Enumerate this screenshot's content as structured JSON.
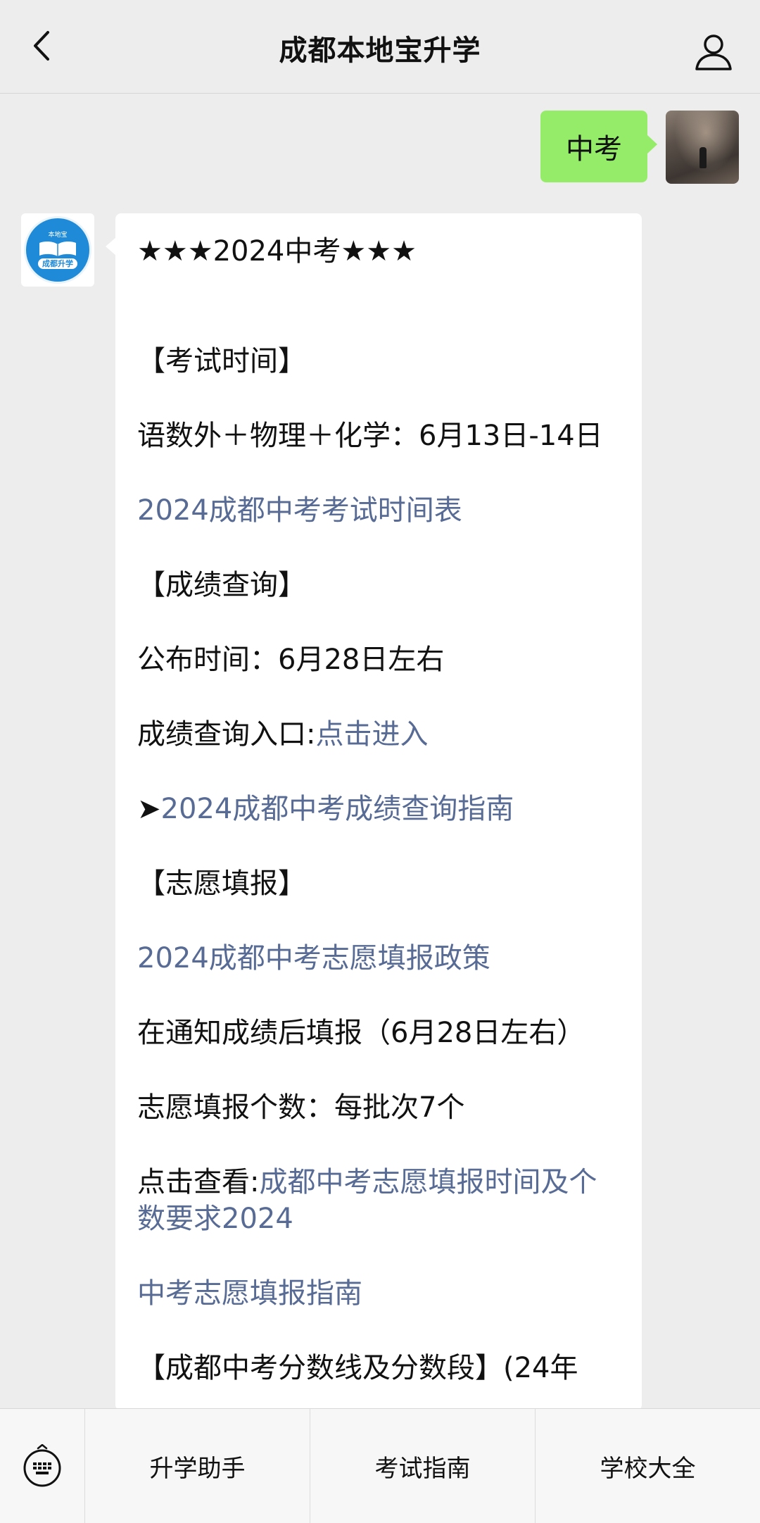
{
  "header": {
    "title": "成都本地宝升学"
  },
  "user_message": {
    "text": "中考"
  },
  "bot_avatar": {
    "brand": "本地宝",
    "name": "成都升学"
  },
  "bot_message": {
    "title": "★★★2024中考★★★",
    "exam_time_heading": "【考试时间】",
    "exam_time_text": "语数外＋物理＋化学：6月13日-14日",
    "exam_schedule_link": "2024成都中考考试时间表",
    "score_query_heading": "【成绩查询】",
    "publish_time": "公布时间：6月28日左右",
    "score_entry_label": "成绩查询入口:",
    "score_entry_link": "点击进入",
    "guide_arrow": "➤",
    "score_guide_link": "2024成都中考成绩查询指南",
    "application_heading": "【志愿填报】",
    "application_policy_link": "2024成都中考志愿填报政策",
    "application_timing": "在通知成绩后填报（6月28日左右）",
    "application_count": "志愿填报个数：每批次7个",
    "check_label": "点击查看:",
    "check_link": "成都中考志愿填报时间及个数要求2024",
    "application_guide_link": "中考志愿填报指南",
    "score_line_heading": "【成都中考分数线及分数段】(24年"
  },
  "bottom_menu": {
    "items": [
      "升学助手",
      "考试指南",
      "学校大全"
    ]
  },
  "colors": {
    "background": "#ededed",
    "user_bubble": "#95ec69",
    "link": "#576b95",
    "avatar_blue": "#1f8ad7"
  },
  "icons": {
    "back": "chevron-left-icon",
    "profile": "person-icon",
    "keyboard": "keyboard-icon"
  }
}
